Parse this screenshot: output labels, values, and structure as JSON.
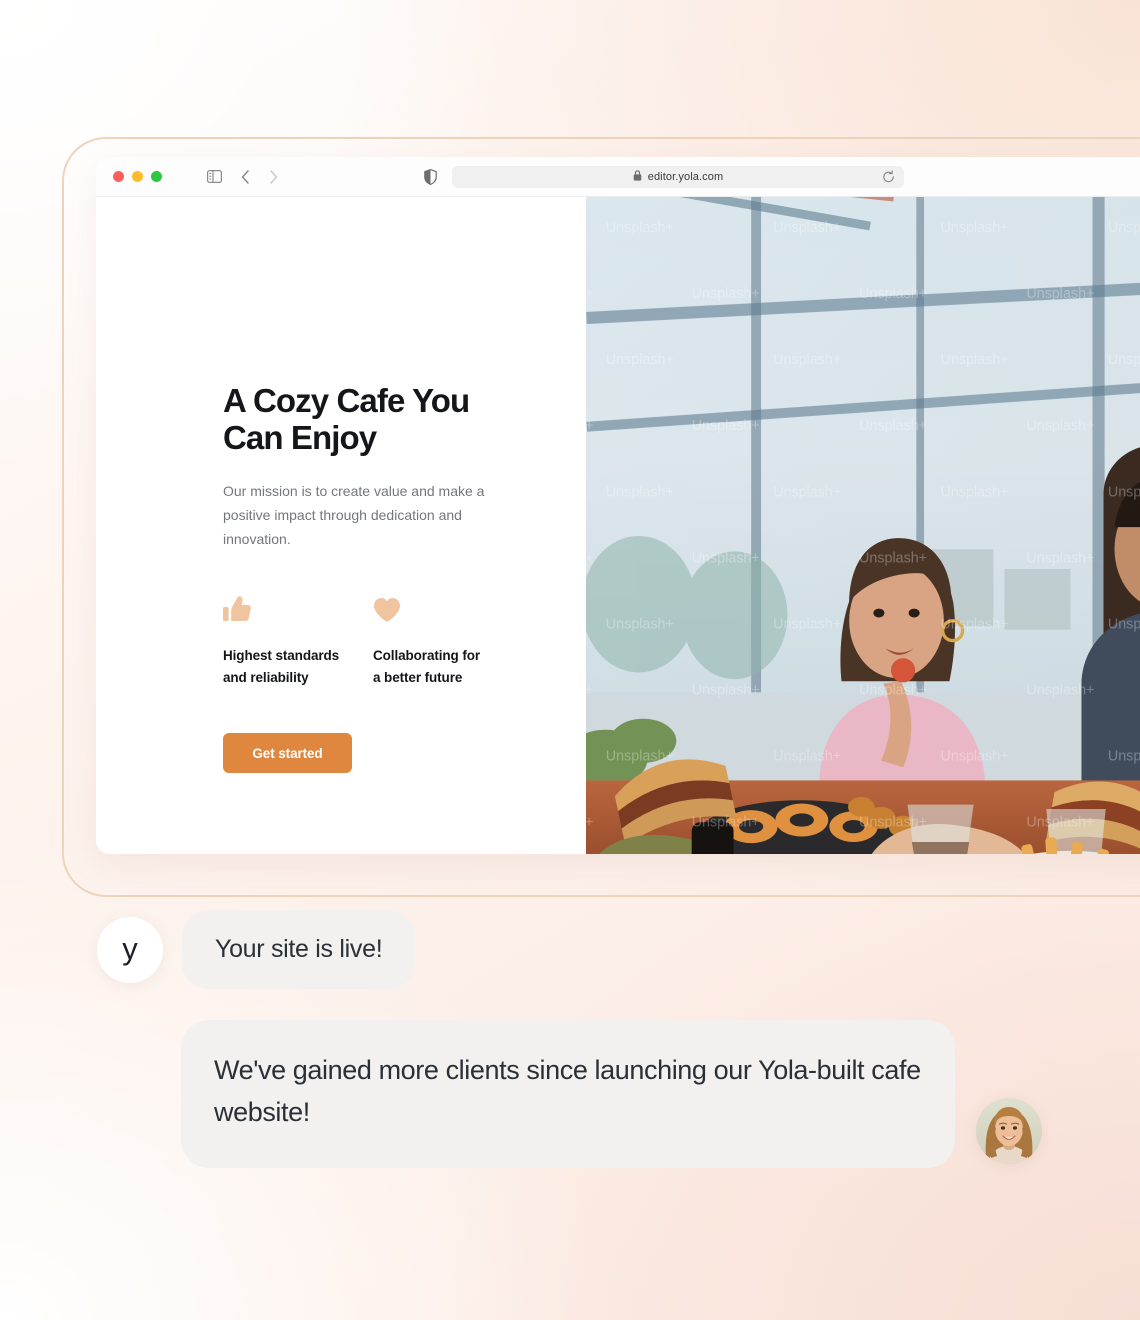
{
  "browser": {
    "traffic_lights": [
      "close",
      "minimize",
      "maximize"
    ],
    "sidebar_icon": "sidebar-toggle-icon",
    "back_icon": "chevron-left-icon",
    "forward_icon": "chevron-right-icon",
    "shield_icon": "shield-icon",
    "lock_icon": "lock-icon",
    "reload_icon": "reload-icon",
    "url": "editor.yola.com"
  },
  "site": {
    "hero_title": "A Cozy Cafe You\nCan Enjoy",
    "hero_subtitle": "Our mission is to create value and make a positive impact through dedication and innovation.",
    "features": [
      {
        "icon": "thumbs-up-icon",
        "label": "Highest standards\nand reliability"
      },
      {
        "icon": "heart-icon",
        "label": "Collaborating for\na better future"
      }
    ],
    "cta_label": "Get started",
    "photo": {
      "alt": "people dining at a cafe table by large windows",
      "watermark": "Unsplash+"
    }
  },
  "chat": {
    "messages": [
      {
        "avatar": "yola-logo-avatar",
        "avatar_letter": "y",
        "text": "Your site is live!"
      },
      {
        "avatar": "client-photo-avatar",
        "text": "We've gained more clients since launching our Yola-built cafe website!"
      }
    ]
  },
  "colors": {
    "accent_orange": "#e0873f",
    "icon_peach": "#efc49f",
    "bubble_gray": "#f2f1f0",
    "frame_border": "#edd3ba",
    "text_dark": "#14161a",
    "text_muted": "#73767c"
  }
}
